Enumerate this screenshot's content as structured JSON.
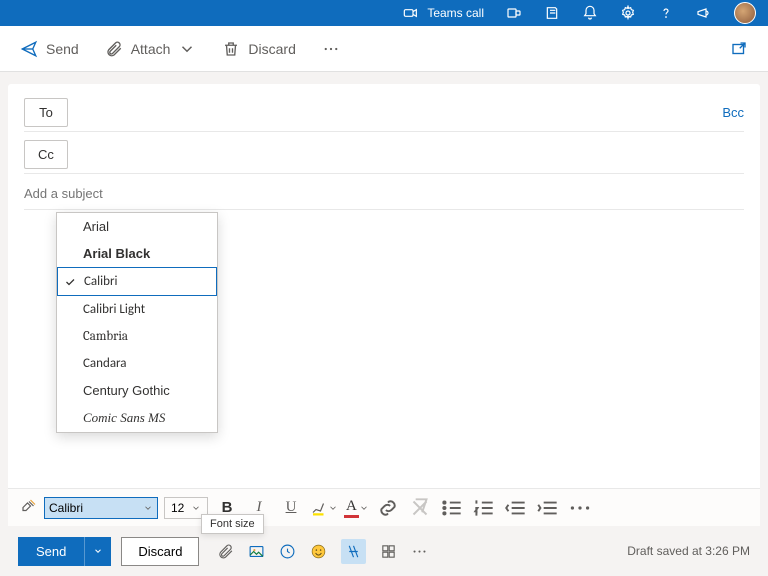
{
  "topbar": {
    "teams_label": "Teams call"
  },
  "cmdbar": {
    "send": "Send",
    "attach": "Attach",
    "discard": "Discard"
  },
  "compose": {
    "to_label": "To",
    "cc_label": "Cc",
    "bcc_label": "Bcc",
    "subject_placeholder": "Add a subject"
  },
  "font_dropdown": {
    "items": [
      {
        "label": "Arial",
        "css": "font-family:Arial"
      },
      {
        "label": "Arial Black",
        "css": "font-family:'Arial Black',Arial;font-weight:900"
      },
      {
        "label": "Calibri",
        "css": "font-family:Calibri,Arial",
        "selected": true
      },
      {
        "label": "Calibri Light",
        "css": "font-family:'Calibri Light',Calibri,Arial;font-weight:300"
      },
      {
        "label": "Cambria",
        "css": "font-family:Cambria,Georgia,serif"
      },
      {
        "label": "Candara",
        "css": "font-family:Candara,Calibri,Arial"
      },
      {
        "label": "Century Gothic",
        "css": "font-family:'Century Gothic',Futura,Arial"
      },
      {
        "label": "Comic Sans MS",
        "css": "font-family:'Comic Sans MS',cursive;font-style:italic"
      }
    ]
  },
  "tooltip": "Font size",
  "format": {
    "font_value": "Calibri",
    "size_value": "12"
  },
  "bottom": {
    "send": "Send",
    "discard": "Discard",
    "status": "Draft saved at 3:26 PM"
  }
}
